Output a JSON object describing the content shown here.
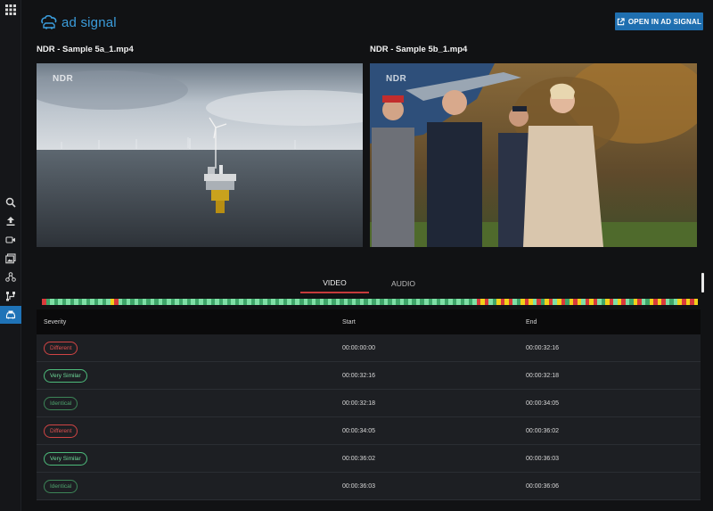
{
  "header": {
    "logo_text": "ad signal",
    "open_button_label": "OPEN IN AD SIGNAL"
  },
  "sidebar": {
    "items": [
      {
        "icon": "apps-grid-icon"
      },
      {
        "icon": "search-icon"
      },
      {
        "icon": "upload-icon"
      },
      {
        "icon": "video-camera-icon"
      },
      {
        "icon": "image-library-icon"
      },
      {
        "icon": "molecule-icon"
      },
      {
        "icon": "compare-icon"
      },
      {
        "icon": "match-car-icon",
        "active": true
      }
    ]
  },
  "videos": [
    {
      "title": "NDR - Sample 5a_1.mp4",
      "watermark": "NDR"
    },
    {
      "title": "NDR - Sample 5b_1.mp4",
      "watermark": "NDR"
    }
  ],
  "tabs": [
    {
      "label": "VIDEO",
      "active": true
    },
    {
      "label": "AUDIO",
      "active": false
    }
  ],
  "colors": {
    "different": "#d93b3b",
    "very_similar": "#7ee0a6",
    "identical": "#3fa66a",
    "yellow": "#f2d21a",
    "accent": "#1f6fb0"
  },
  "timeline": [
    "R",
    "I",
    "V",
    "I",
    "V",
    "I",
    "V",
    "I",
    "V",
    "I",
    "V",
    "I",
    "V",
    "I",
    "V",
    "I",
    "V",
    "Y",
    "R",
    "V",
    "I",
    "V",
    "I",
    "V",
    "I",
    "V",
    "I",
    "V",
    "I",
    "V",
    "I",
    "V",
    "I",
    "V",
    "I",
    "V",
    "I",
    "V",
    "I",
    "V",
    "I",
    "V",
    "I",
    "V",
    "I",
    "V",
    "I",
    "V",
    "I",
    "V",
    "I",
    "V",
    "I",
    "V",
    "I",
    "V",
    "I",
    "V",
    "I",
    "V",
    "I",
    "V",
    "I",
    "V",
    "I",
    "V",
    "I",
    "V",
    "I",
    "V",
    "I",
    "V",
    "I",
    "V",
    "I",
    "V",
    "I",
    "V",
    "I",
    "V",
    "I",
    "V",
    "I",
    "V",
    "I",
    "V",
    "I",
    "V",
    "I",
    "V",
    "I",
    "V",
    "I",
    "V",
    "I",
    "V",
    "I",
    "V",
    "I",
    "V",
    "I",
    "V",
    "I",
    "V",
    "I",
    "V",
    "I",
    "V",
    "R",
    "Y",
    "R",
    "V",
    "I",
    "Y",
    "R",
    "Y",
    "R",
    "V",
    "I",
    "Y",
    "R",
    "Y",
    "V",
    "R",
    "I",
    "Y",
    "R",
    "V",
    "Y",
    "R",
    "I",
    "Y",
    "R",
    "Y",
    "V",
    "R",
    "Y",
    "R",
    "V",
    "I",
    "Y",
    "R",
    "V",
    "Y",
    "R",
    "V",
    "I",
    "Y",
    "R",
    "V",
    "I",
    "Y",
    "R",
    "Y",
    "R",
    "V",
    "I",
    "V",
    "Y",
    "R",
    "Y",
    "R",
    "Y"
  ],
  "table": {
    "headers": {
      "severity": "Severity",
      "start": "Start",
      "end": "End"
    },
    "rows": [
      {
        "severity": "Different",
        "start": "00:00:00:00",
        "end": "00:00:32:16"
      },
      {
        "severity": "Very Similar",
        "start": "00:00:32:16",
        "end": "00:00:32:18"
      },
      {
        "severity": "Identical",
        "start": "00:00:32:18",
        "end": "00:00:34:05"
      },
      {
        "severity": "Different",
        "start": "00:00:34:05",
        "end": "00:00:36:02"
      },
      {
        "severity": "Very Similar",
        "start": "00:00:36:02",
        "end": "00:00:36:03"
      },
      {
        "severity": "Identical",
        "start": "00:00:36:03",
        "end": "00:00:36:06"
      }
    ]
  }
}
